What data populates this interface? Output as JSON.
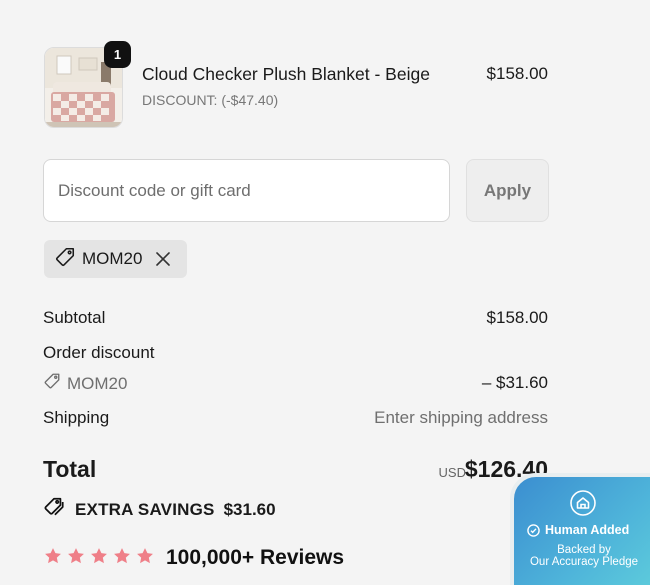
{
  "product": {
    "quantity": "1",
    "name": "Cloud Checker Plush Blanket - Beige",
    "discount_text": "DISCOUNT: (-$47.40)",
    "price": "$158.00"
  },
  "discount_form": {
    "placeholder": "Discount code or gift card",
    "value": "",
    "apply_label": "Apply"
  },
  "applied_code": {
    "code": "MOM20",
    "tag_icon": "tag-icon",
    "remove_icon": "close-icon"
  },
  "summary": {
    "subtotal_label": "Subtotal",
    "subtotal_value": "$158.00",
    "order_discount_label": "Order discount",
    "order_discount_code": "MOM20",
    "order_discount_value": "– $31.60",
    "shipping_label": "Shipping",
    "shipping_value": "Enter shipping address",
    "total_label": "Total",
    "total_currency": "USD",
    "total_value": "$126.40",
    "savings_label": "EXTRA SAVINGS",
    "savings_value": "$31.60"
  },
  "reviews": {
    "rating_stars": 5,
    "label": "100,000+ Reviews",
    "star_color": "#ef7f88"
  },
  "pledge": {
    "title": "Human Added",
    "line1": "Backed by",
    "line2": "Our Accuracy Pledge"
  }
}
